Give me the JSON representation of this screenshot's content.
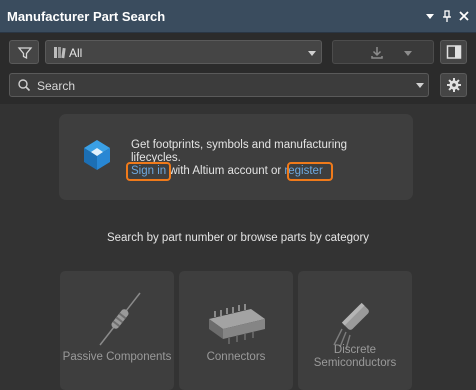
{
  "panel": {
    "title": "Manufacturer Part Search"
  },
  "toolbar": {
    "filter_icon": "filter-icon",
    "category_dropdown": {
      "value": "All",
      "icon": "parts-library-icon"
    },
    "download_icon": "download-icon",
    "layout_icon": "split-panel-icon"
  },
  "search": {
    "value": "Search",
    "icon": "search-icon",
    "settings_icon": "gear-icon"
  },
  "signin_card": {
    "line1": "Get footprints, symbols and manufacturing",
    "line2": "lifecycles.",
    "signin_link": "Sign in",
    "middle_text": " with Altium account or ",
    "register_link": "register",
    "highlight_color": "#f07a1a"
  },
  "hint": "Search by part number or browse parts by category",
  "categories": [
    {
      "label": "Passive Components",
      "icon": "resistor-icon"
    },
    {
      "label": "Connectors",
      "icon": "connector-icon"
    },
    {
      "label_line1": "Discrete",
      "label_line2": "Semiconductors",
      "icon": "transistor-icon"
    }
  ],
  "colors": {
    "titlebar": "#3a4c5e",
    "link": "#6ea8de",
    "accent": "#f07a1a"
  }
}
